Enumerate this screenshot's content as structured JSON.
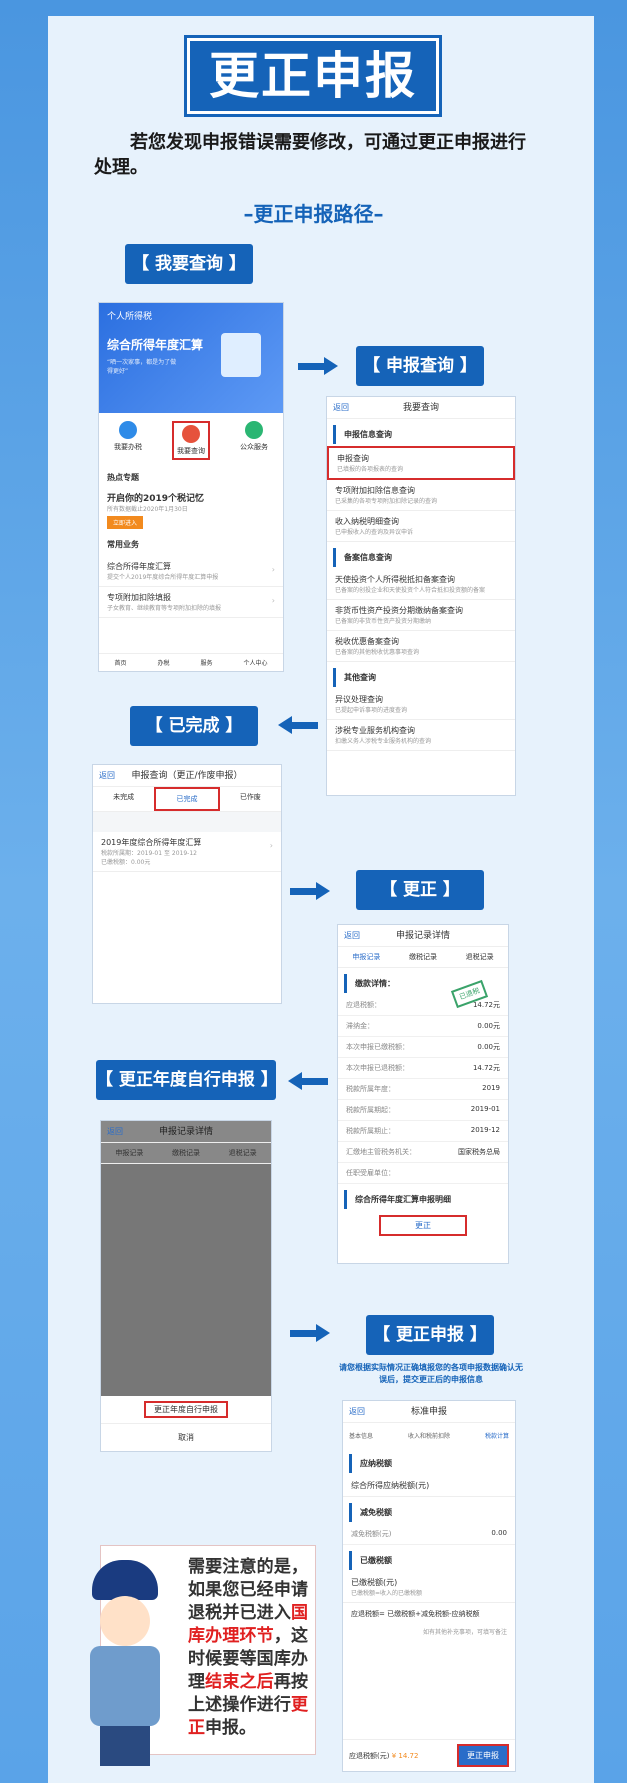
{
  "title": "更正申报",
  "intro": "若您发现申报错误需要修改，可通过更正申报进行处理。",
  "route": "–更正申报路径–",
  "labels": {
    "l1": "【 我要查询 】",
    "l2": "【 申报查询 】",
    "l3": "【 已完成 】",
    "l4": "【 更正 】",
    "l5": "【 更正年度自行申报 】",
    "l6": "【 更正申报 】"
  },
  "instruction": "请您根据实际情况正确填报您的各项申报数据确认无误后，提交更正后的申报信息",
  "p1": {
    "app": "个人所得税",
    "banner": "综合所得年度汇算",
    "banner_sub": "“晒一次家事，都是为了做得更好”",
    "icons": [
      "我要办税",
      "我要查询",
      "公众服务"
    ],
    "hot": "热点专题",
    "hot_title": "开启你的2019个税记忆",
    "hot_sub": "所有数据截止2020年1月30日",
    "hot_btn": "立即进入",
    "common": "常用业务",
    "c1": "综合所得年度汇算",
    "c1s": "提交个人2019年度综合所得年度汇算申报",
    "c2": "专项附加扣除填报",
    "c2s": "子女教育、继续教育等专项附加扣除的填报",
    "tabs": [
      "首页",
      "办税",
      "服务",
      "个人中心"
    ]
  },
  "p2": {
    "back": "返回",
    "title": "我要查询",
    "s1": "申报信息查询",
    "items1": [
      {
        "t": "申报查询",
        "s": "已填报的各项报表的查询"
      },
      {
        "t": "专项附加扣除信息查询",
        "s": "已采集的各项专项附加扣除记录的查询"
      },
      {
        "t": "收入纳税明细查询",
        "s": "已申报收入的查询及异议申诉"
      }
    ],
    "s2": "备案信息查询",
    "items2": [
      {
        "t": "天使投资个人所得税抵扣备案查询",
        "s": "已备案的创投企业和天使投资个人符合抵扣投资额的备案"
      },
      {
        "t": "非货币性资产投资分期缴纳备案查询",
        "s": "已备案的非货币性资产投资分期缴纳"
      },
      {
        "t": "税收优惠备案查询",
        "s": "已备案的其他税收优惠事项查询"
      }
    ],
    "s3": "其他查询",
    "items3": [
      {
        "t": "异议处理查询",
        "s": "已提起申诉事项的进度查询"
      },
      {
        "t": "涉税专业服务机构查询",
        "s": "扣缴义务人涉税专业服务机构的查询"
      }
    ]
  },
  "p3": {
    "back": "返回",
    "title": "申报查询（更正/作废申报）",
    "tabs": [
      "未完成",
      "已完成",
      "已作废"
    ],
    "item": "2019年度综合所得年度汇算",
    "l1": "税款所属期：2019-01 至 2019-12",
    "l2": "已缴税额：0.00元"
  },
  "p4": {
    "back": "返回",
    "title": "申报记录详情",
    "tabs": [
      "申报记录",
      "缴税记录",
      "退税记录"
    ],
    "sec": "缴款详情：",
    "rows": [
      [
        "应退税额：",
        "14.72元"
      ],
      [
        "滞纳金：",
        "0.00元"
      ],
      [
        "本次申报已缴税额：",
        "0.00元"
      ],
      [
        "本次申报已退税额：",
        "14.72元"
      ],
      [
        "税款所属年度：",
        "2019"
      ],
      [
        "税款所属期起：",
        "2019-01"
      ],
      [
        "税款所属期止：",
        "2019-12"
      ],
      [
        "汇缴地主管税务机关：",
        "国家税务总局"
      ],
      [
        "任职受雇单位：",
        ""
      ]
    ],
    "stamp": "已退税",
    "sec2": "综合所得年度汇算申报明细",
    "btn": "更正"
  },
  "p5": {
    "back": "返回",
    "title": "申报记录详情",
    "tabs": [
      "申报记录",
      "缴税记录",
      "退税记录"
    ],
    "action": "更正年度自行申报",
    "cancel": "取消"
  },
  "p6": {
    "back": "返回",
    "title": "标准申报",
    "steps": [
      "基本信息",
      "收入和税前扣除",
      "税款计算"
    ],
    "sec1": "应纳税额",
    "r1": "综合所得应纳税额(元)",
    "sec2": "减免税额",
    "r2": "减免税额(元)",
    "r2v": "0.00",
    "sec3": "已缴税额",
    "r3": "已缴税额(元)",
    "r3s": "已缴税额=收入的已缴税额",
    "formula": "应退税额= 已缴税额+减免税额-应纳税额",
    "tip": "如有其他补充事项，可填写备注",
    "bottom": "应退税额(元)",
    "amount": "¥ 14.72",
    "submit": "更正申报"
  },
  "note": {
    "a": "需要注意的是，如果您已经申请退税并已进入",
    "b": "国库办理环节",
    "c": "，这时候要等国库办理",
    "d": "结束之后",
    "e": "再按上述操作进行",
    "f": "更正",
    "g": "申报。"
  }
}
